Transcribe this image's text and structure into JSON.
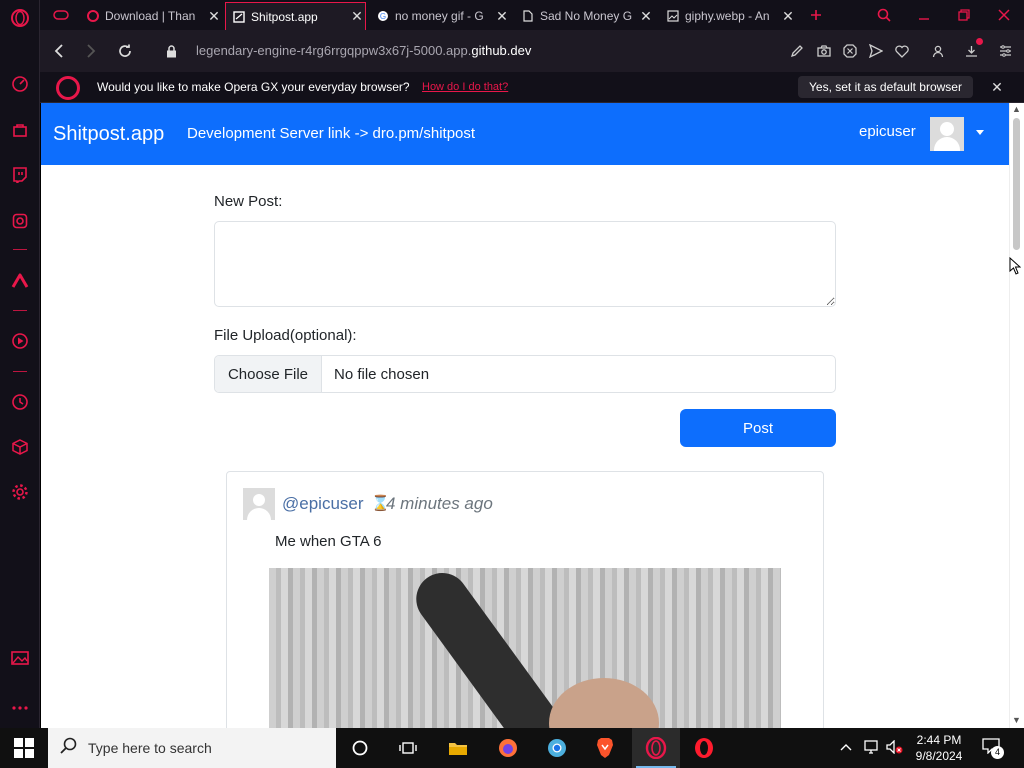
{
  "browser": {
    "tabs": [
      {
        "title": "Download | Than",
        "icon": "opera-icon"
      },
      {
        "title": "Shitpost.app",
        "icon": "page-icon"
      },
      {
        "title": "no money gif - G",
        "icon": "google-icon"
      },
      {
        "title": "Sad No Money G",
        "icon": "document-icon"
      },
      {
        "title": "giphy.webp - An",
        "icon": "image-icon"
      }
    ],
    "active_tab": "Shitpost.app",
    "url_prefix": "legendary-engine-r4rg6rrgqppw3x67j-5000.app.",
    "url_domain": "github.dev",
    "infobar": {
      "message": "Would you like to make Opera GX your everyday browser?",
      "how_link": "How do I do that?",
      "yes_button": "Yes, set it as default browser"
    },
    "accent_color": "#e8174a"
  },
  "site": {
    "brand": "Shitpost.app",
    "dev_link": "Development Server link -> dro.pm/shitpost",
    "username": "epicuser",
    "navbar_color": "#0d6efd"
  },
  "form": {
    "new_post_label": "New Post:",
    "new_post_value": "",
    "file_label": "File Upload(optional):",
    "choose_file": "Choose File",
    "no_file": "No file chosen",
    "post_button": "Post"
  },
  "posts": [
    {
      "handle": "@epicuser",
      "time": "4 minutes ago",
      "text": "Me when GTA 6"
    }
  ],
  "taskbar": {
    "search_placeholder": "Type here to search",
    "time": "2:44 PM",
    "date": "9/8/2024",
    "notifications": "4"
  }
}
